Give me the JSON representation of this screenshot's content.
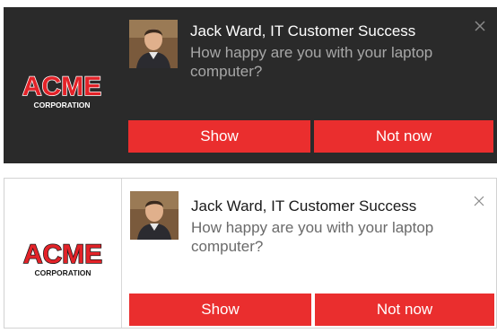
{
  "notifications": [
    {
      "theme": "dark",
      "sender": "Jack Ward, IT Customer Success",
      "message": "How happy are you with your laptop computer?",
      "actions": {
        "primary": "Show",
        "secondary": "Not now"
      },
      "logo_text": {
        "main": "ACME",
        "sub": "CORPORATION"
      },
      "icons": {
        "close": "close-icon",
        "avatar": "user-photo"
      }
    },
    {
      "theme": "light",
      "sender": "Jack Ward, IT Customer Success",
      "message": "How happy are you with your laptop computer?",
      "actions": {
        "primary": "Show",
        "secondary": "Not now"
      },
      "logo_text": {
        "main": "ACME",
        "sub": "CORPORATION"
      },
      "icons": {
        "close": "close-icon",
        "avatar": "user-photo"
      }
    }
  ],
  "colors": {
    "dark_background": "#2a2a2a",
    "button_red": "#ea2e2e",
    "logo_red": "#e32228"
  }
}
